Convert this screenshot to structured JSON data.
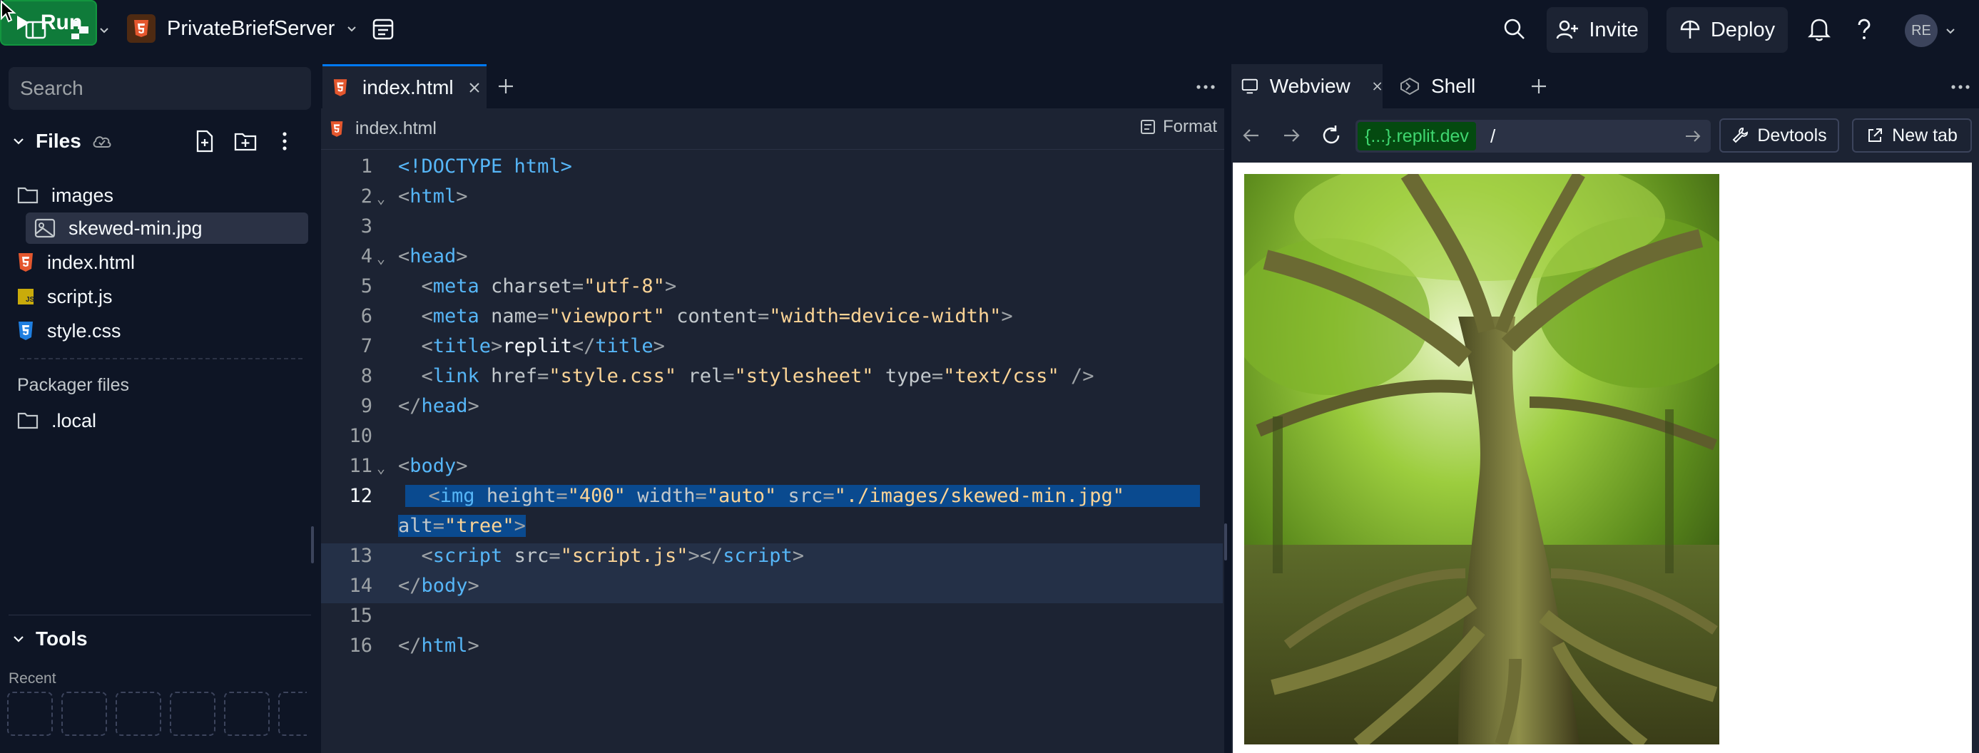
{
  "topbar": {
    "project_name": "PrivateBriefServer",
    "run_label": "Run",
    "invite_label": "Invite",
    "deploy_label": "Deploy",
    "avatar_initials": "RE"
  },
  "sidebar": {
    "search_placeholder": "Search",
    "files_label": "Files",
    "files": [
      {
        "name": "images",
        "type": "folder"
      },
      {
        "name": "skewed-min.jpg",
        "type": "image"
      },
      {
        "name": "index.html",
        "type": "html"
      },
      {
        "name": "script.js",
        "type": "js"
      },
      {
        "name": "style.css",
        "type": "css"
      }
    ],
    "packager_label": "Packager files",
    "packager_files": [
      {
        "name": ".local",
        "type": "folder"
      }
    ],
    "tools_label": "Tools",
    "recent_label": "Recent"
  },
  "editor": {
    "tab_label": "index.html",
    "breadcrumb": "index.html",
    "format_label": "Format",
    "active_line": 12,
    "lines": [
      {
        "n": "1",
        "tokens": [
          [
            "dt",
            "<!DOCTYPE html>"
          ]
        ]
      },
      {
        "n": "2",
        "fold": true,
        "tokens": [
          [
            "punc",
            "<"
          ],
          [
            "tag",
            "html"
          ],
          [
            "punc",
            ">"
          ]
        ]
      },
      {
        "n": "3",
        "tokens": []
      },
      {
        "n": "4",
        "fold": true,
        "tokens": [
          [
            "punc",
            "<"
          ],
          [
            "tag",
            "head"
          ],
          [
            "punc",
            ">"
          ]
        ]
      },
      {
        "n": "5",
        "tokens": [
          [
            "txt",
            "  "
          ],
          [
            "punc",
            "<"
          ],
          [
            "tag",
            "meta"
          ],
          [
            "txt",
            " "
          ],
          [
            "attr",
            "charset"
          ],
          [
            "punc",
            "="
          ],
          [
            "str",
            "\"utf-8\""
          ],
          [
            "punc",
            ">"
          ]
        ]
      },
      {
        "n": "6",
        "tokens": [
          [
            "txt",
            "  "
          ],
          [
            "punc",
            "<"
          ],
          [
            "tag",
            "meta"
          ],
          [
            "txt",
            " "
          ],
          [
            "attr",
            "name"
          ],
          [
            "punc",
            "="
          ],
          [
            "str",
            "\"viewport\""
          ],
          [
            "txt",
            " "
          ],
          [
            "attr",
            "content"
          ],
          [
            "punc",
            "="
          ],
          [
            "str",
            "\"width=device-width\""
          ],
          [
            "punc",
            ">"
          ]
        ]
      },
      {
        "n": "7",
        "tokens": [
          [
            "txt",
            "  "
          ],
          [
            "punc",
            "<"
          ],
          [
            "tag",
            "title"
          ],
          [
            "punc",
            ">"
          ],
          [
            "txt",
            "replit"
          ],
          [
            "punc",
            "</"
          ],
          [
            "tag",
            "title"
          ],
          [
            "punc",
            ">"
          ]
        ]
      },
      {
        "n": "8",
        "tokens": [
          [
            "txt",
            "  "
          ],
          [
            "punc",
            "<"
          ],
          [
            "tag",
            "link"
          ],
          [
            "txt",
            " "
          ],
          [
            "attr",
            "href"
          ],
          [
            "punc",
            "="
          ],
          [
            "str",
            "\"style.css\""
          ],
          [
            "txt",
            " "
          ],
          [
            "attr",
            "rel"
          ],
          [
            "punc",
            "="
          ],
          [
            "str",
            "\"stylesheet\""
          ],
          [
            "txt",
            " "
          ],
          [
            "attr",
            "type"
          ],
          [
            "punc",
            "="
          ],
          [
            "str",
            "\"text/css\""
          ],
          [
            "txt",
            " "
          ],
          [
            "punc",
            "/>"
          ]
        ]
      },
      {
        "n": "9",
        "tokens": [
          [
            "punc",
            "</"
          ],
          [
            "tag",
            "head"
          ],
          [
            "punc",
            ">"
          ]
        ]
      },
      {
        "n": "10",
        "tokens": []
      },
      {
        "n": "11",
        "fold": true,
        "tokens": [
          [
            "punc",
            "<"
          ],
          [
            "tag",
            "body"
          ],
          [
            "punc",
            ">"
          ]
        ]
      },
      {
        "n": "12",
        "tokens": [
          [
            "txt",
            "  "
          ],
          [
            "punc",
            "<"
          ],
          [
            "tag",
            "img"
          ],
          [
            "txt",
            " "
          ],
          [
            "attr",
            "height"
          ],
          [
            "punc",
            "="
          ],
          [
            "str",
            "\"400\""
          ],
          [
            "txt",
            " "
          ],
          [
            "attr",
            "width"
          ],
          [
            "punc",
            "="
          ],
          [
            "str",
            "\"auto\""
          ],
          [
            "txt",
            " "
          ],
          [
            "attr",
            "src"
          ],
          [
            "punc",
            "="
          ],
          [
            "str",
            "\"./images/skewed-min.jpg\""
          ]
        ]
      },
      {
        "n": "",
        "tokens": [
          [
            "attr",
            "alt"
          ],
          [
            "punc",
            "="
          ],
          [
            "str",
            "\"tree\""
          ],
          [
            "punc",
            ">"
          ]
        ]
      },
      {
        "n": "13",
        "tokens": [
          [
            "txt",
            "  "
          ],
          [
            "punc",
            "<"
          ],
          [
            "tag",
            "script"
          ],
          [
            "txt",
            " "
          ],
          [
            "attr",
            "src"
          ],
          [
            "punc",
            "="
          ],
          [
            "str",
            "\"script.js\""
          ],
          [
            "punc",
            "></"
          ],
          [
            "tag",
            "script"
          ],
          [
            "punc",
            ">"
          ]
        ]
      },
      {
        "n": "14",
        "tokens": [
          [
            "punc",
            "</"
          ],
          [
            "tag",
            "body"
          ],
          [
            "punc",
            ">"
          ]
        ]
      },
      {
        "n": "15",
        "tokens": []
      },
      {
        "n": "16",
        "tokens": [
          [
            "punc",
            "</"
          ],
          [
            "tag",
            "html"
          ],
          [
            "punc",
            ">"
          ]
        ]
      }
    ]
  },
  "rightpane": {
    "webview_label": "Webview",
    "shell_label": "Shell",
    "url_domain": "{...}.replit.dev",
    "url_path": "/",
    "devtools_label": "Devtools",
    "newtab_label": "New tab",
    "preview_image_alt": "tree"
  },
  "colors": {
    "bg": "#0e1525",
    "panel": "#1c2333",
    "accent": "#0079f2",
    "run_green": "#0f7b3a",
    "selection": "#0a4a8f"
  }
}
